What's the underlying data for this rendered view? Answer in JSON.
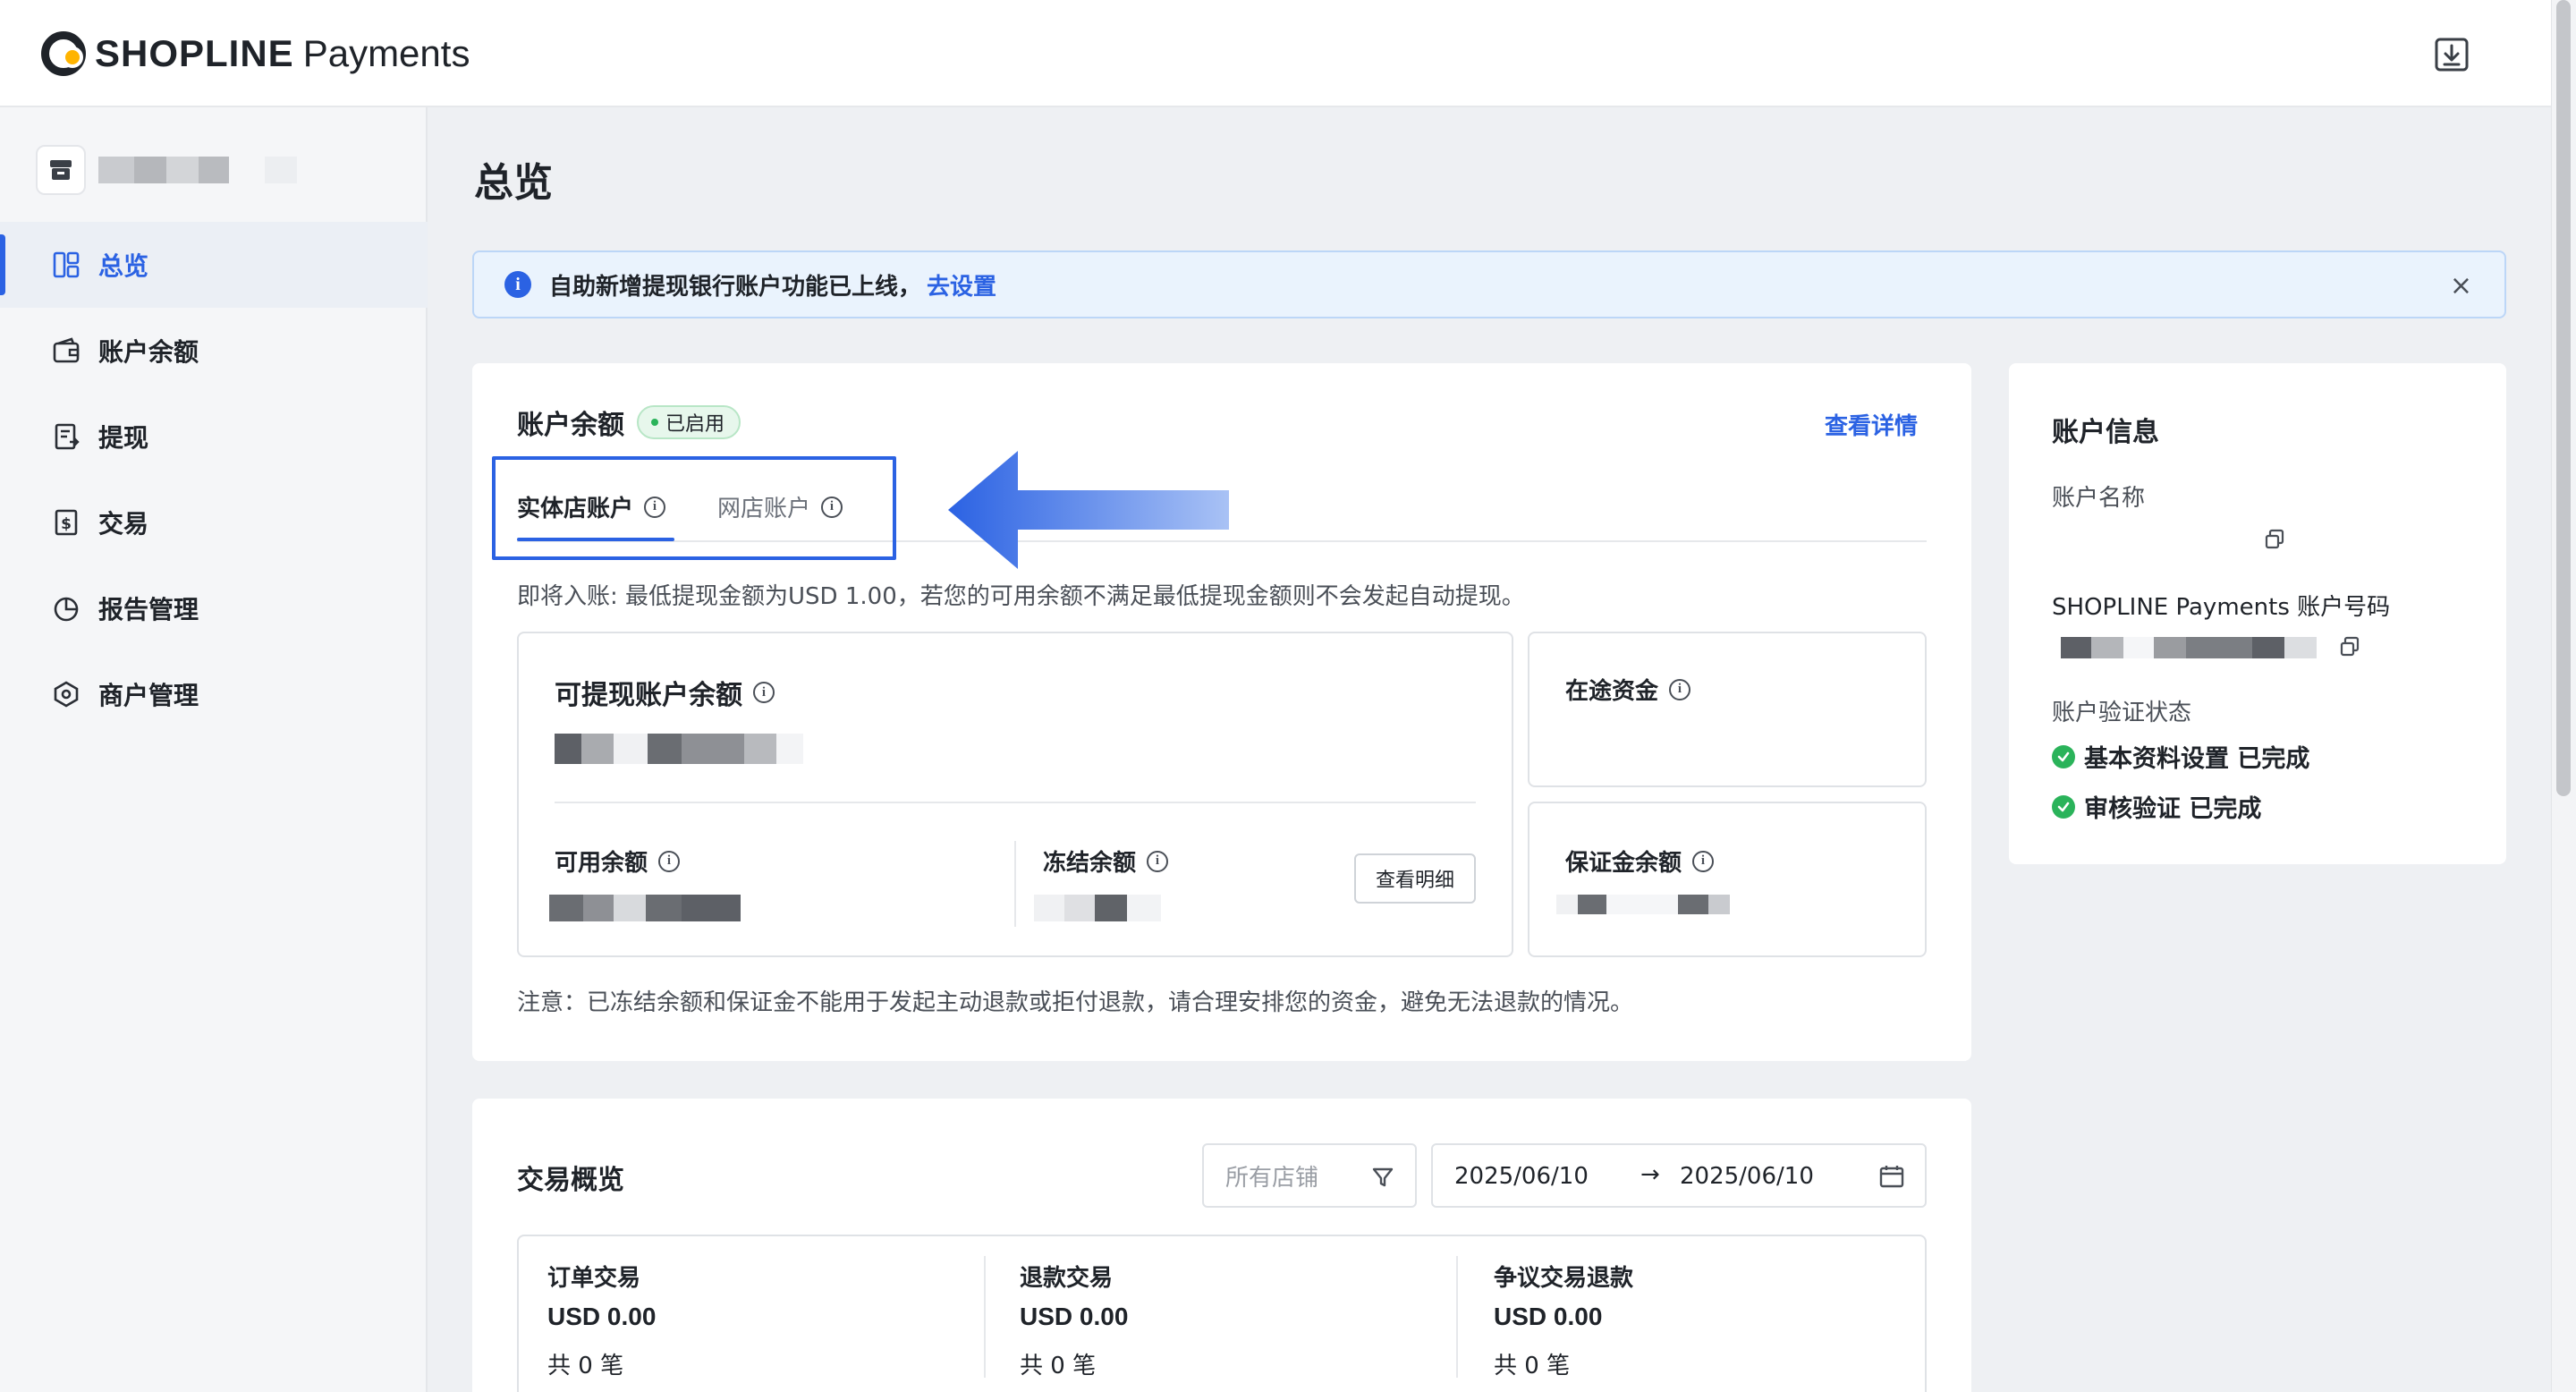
{
  "brand": {
    "name": "SHOPLINE",
    "product": "Payments"
  },
  "sidebar": {
    "items": [
      {
        "label": "总览",
        "icon": "dashboard-icon",
        "active": true
      },
      {
        "label": "账户余额",
        "icon": "wallet-icon",
        "active": false
      },
      {
        "label": "提现",
        "icon": "withdraw-icon",
        "active": false
      },
      {
        "label": "交易",
        "icon": "transaction-icon",
        "active": false
      },
      {
        "label": "报告管理",
        "icon": "report-icon",
        "active": false
      },
      {
        "label": "商户管理",
        "icon": "merchant-icon",
        "active": false
      }
    ]
  },
  "page": {
    "title": "总览"
  },
  "notice": {
    "text": "自助新增提现银行账户功能已上线，",
    "link": "去设置",
    "close": "×"
  },
  "balance": {
    "title": "账户余额",
    "status_badge": "已启用",
    "detail_link": "查看详情",
    "tabs": [
      "实体店账户",
      "网店账户"
    ],
    "active_tab": "实体店账户",
    "incoming_note": "即将入账: 最低提现金额为USD 1.00，若您的可用余额不满足最低提现金额则不会发起自动提现。",
    "withdrawable_label": "可提现账户余额",
    "available_label": "可用余额",
    "frozen_label": "冻结余额",
    "view_detail_button": "查看明细",
    "in_transit_label": "在途资金",
    "deposit_label": "保证金余额",
    "footnote": "注意：已冻结余额和保证金不能用于发起主动退款或拒付退款，请合理安排您的资金，避免无法退款的情况。"
  },
  "account_info": {
    "title": "账户信息",
    "name_label": "账户名称",
    "number_label": "SHOPLINE Payments 账户号码",
    "verify_label": "账户验证状态",
    "statuses": [
      "基本资料设置 已完成",
      "审核验证 已完成"
    ]
  },
  "trade": {
    "title": "交易概览",
    "store_filter_placeholder": "所有店铺",
    "date_start": "2025/06/10",
    "date_separator": "→",
    "date_end": "2025/06/10",
    "stats": [
      {
        "label": "订单交易",
        "value": "USD 0.00",
        "count": "共 0 笔"
      },
      {
        "label": "退款交易",
        "value": "USD 0.00",
        "count": "共 0 笔"
      },
      {
        "label": "争议交易退款",
        "value": "USD 0.00",
        "count": "共 0 笔"
      }
    ]
  },
  "colors": {
    "accent": "#2b62e3",
    "success": "#2ab35a",
    "notice_bg": "#eaf3fd"
  }
}
